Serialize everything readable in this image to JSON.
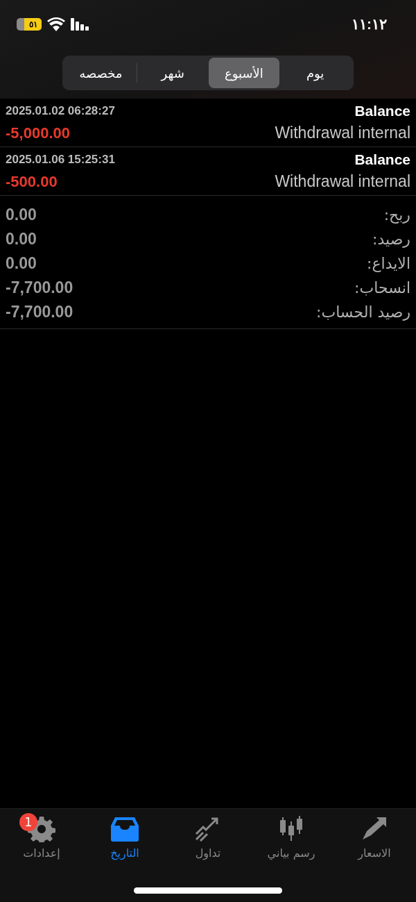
{
  "status_bar": {
    "time": "١١:١٢",
    "battery": "٥١"
  },
  "period_tabs": [
    {
      "label": "يوم",
      "selected": false
    },
    {
      "label": "الأسبوع",
      "selected": true
    },
    {
      "label": "شهر",
      "selected": false
    },
    {
      "label": "مخصصه",
      "selected": false
    }
  ],
  "deals": [
    {
      "type": "Balance",
      "time": "2025.01.02 06:28:27",
      "comment": "Withdrawal internal",
      "amount": "-5,000.00"
    },
    {
      "type": "Balance",
      "time": "2025.01.06 15:25:31",
      "comment": "Withdrawal internal",
      "amount": "-500.00"
    }
  ],
  "summary": [
    {
      "label": "ربح:",
      "value": "0.00"
    },
    {
      "label": "رصيد:",
      "value": "0.00"
    },
    {
      "label": "الايداع:",
      "value": "0.00"
    },
    {
      "label": "انسحاب:",
      "value": "-7,700.00"
    },
    {
      "label": "رصيد الحساب:",
      "value": "-7,700.00"
    }
  ],
  "tab_bar": [
    {
      "kind": "quotes",
      "label": "الاسعار",
      "selected": false
    },
    {
      "kind": "chart",
      "label": "رسم بياني",
      "selected": false
    },
    {
      "kind": "trade",
      "label": "تداول",
      "selected": false
    },
    {
      "kind": "history",
      "label": "التاريخ",
      "selected": true
    },
    {
      "kind": "settings",
      "label": "إعدادات",
      "selected": false,
      "badge": "1"
    }
  ]
}
